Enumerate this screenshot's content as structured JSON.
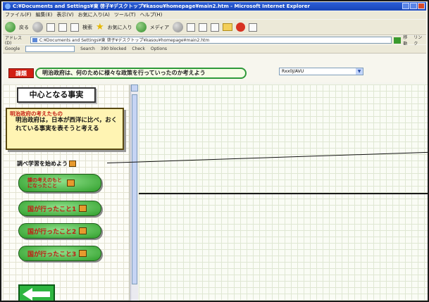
{
  "window": {
    "title": "C:¥Documents and Settings¥東 啓子¥デスクトップ¥kasou¥homepage¥main2.htm - Microsoft Internet Explorer"
  },
  "menu": [
    "ファイル(F)",
    "編集(E)",
    "表示(V)",
    "お気に入り(A)",
    "ツール(T)",
    "ヘルプ(H)"
  ],
  "toolbar": {
    "back_label": "戻る",
    "search_label": "検索",
    "favorites_label": "お気に入り",
    "media_label": "メディア"
  },
  "address": {
    "label": "アドレス(D)",
    "value": "C:¥Documents and Settings¥東 啓子¥デスクトップ¥kasou¥homepage¥main2.htm",
    "go_label": "移動",
    "links_label": "リンク"
  },
  "googlebar": {
    "label": "Google",
    "search_label": "Search",
    "blocked_label": "390 blocked",
    "check_label": "Check",
    "options_label": "Options"
  },
  "header": {
    "kadai_badge": "課題",
    "question": "明治政府は、何のために様々な政策を行っていったのか考えよう",
    "select_value": "Rxx0J/AVU"
  },
  "left": {
    "core_title": "中心となる事実",
    "note_head": "明治政府の考えたもの",
    "note_body": "明治政府は，日本が西洋に比べ，おくれている事実を表そうと考える",
    "research_label": "調べ学習を始めよう",
    "pills": [
      {
        "label": "課の考えのもとになったこと"
      },
      {
        "label": "国が行ったこと1"
      },
      {
        "label": "国が行ったこと2"
      },
      {
        "label": "国が行ったこと3"
      }
    ]
  }
}
